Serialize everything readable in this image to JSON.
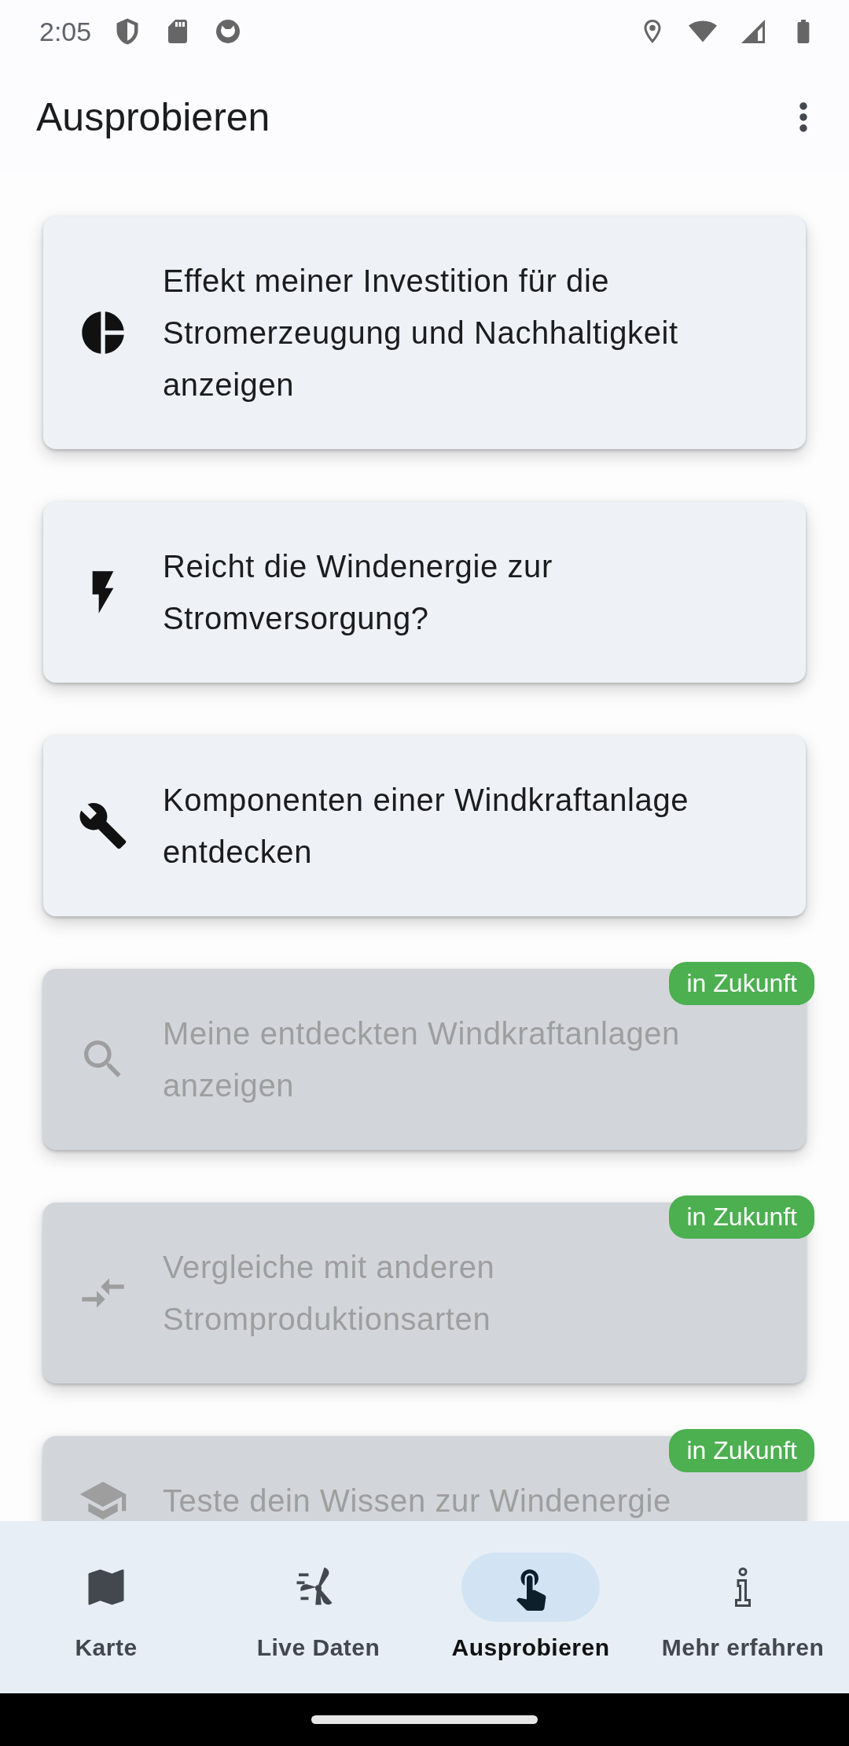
{
  "status_bar": {
    "time": "2:05"
  },
  "app_bar": {
    "title": "Ausprobieren"
  },
  "cards": [
    {
      "text": "Effekt meiner Investition für die Stromerzeugung und Nachhaltigkeit anzeigen",
      "disabled": false
    },
    {
      "text": "Reicht die Windenergie zur Stromversorgung?",
      "disabled": false
    },
    {
      "text": "Komponenten einer Windkraftanlage entdecken",
      "disabled": false
    },
    {
      "text": "Meine entdeckten Windkraftanlagen anzeigen",
      "disabled": true,
      "badge": "in Zukunft"
    },
    {
      "text": "Vergleiche mit anderen Stromproduktionsarten",
      "disabled": true,
      "badge": "in Zukunft"
    },
    {
      "text": "Teste dein Wissen zur Windenergie",
      "disabled": true,
      "badge": "in Zukunft"
    }
  ],
  "bottom_nav": [
    {
      "label": "Karte",
      "selected": false
    },
    {
      "label": "Live Daten",
      "selected": false
    },
    {
      "label": "Ausprobieren",
      "selected": true
    },
    {
      "label": "Mehr erfahren",
      "selected": false
    }
  ]
}
